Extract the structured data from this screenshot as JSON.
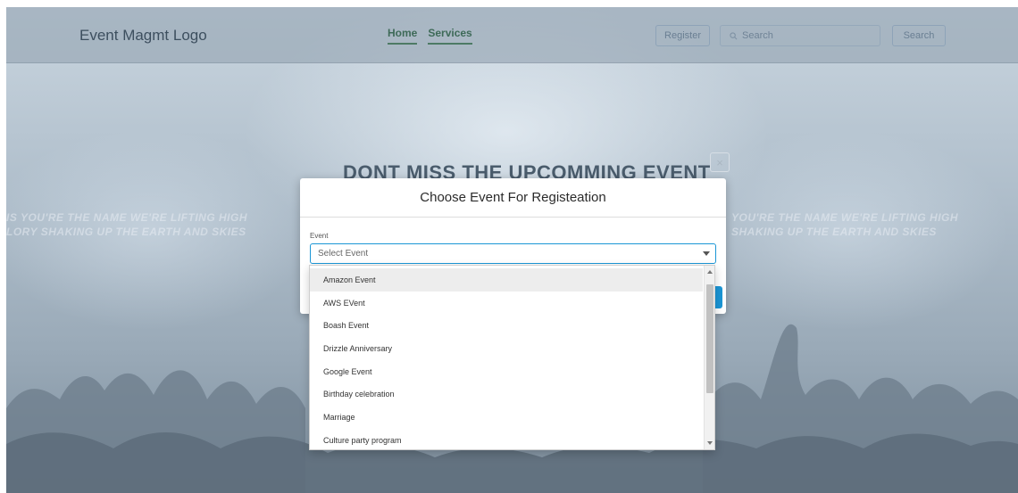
{
  "navbar": {
    "logo": "Event Magmt Logo",
    "links": [
      "Home",
      "Services"
    ],
    "register_label": "Register",
    "search_placeholder": "Search",
    "search_button": "Search"
  },
  "hero": {
    "title": "DONT MISS THE UPCOMMING EVENT",
    "left_text": [
      "IS YOU'RE THE NAME WE'RE LIFTING HIGH",
      "LORY SHAKING UP THE EARTH AND SKIES"
    ],
    "right_text": [
      "YOU'RE THE NAME WE'RE LIFTING HIGH",
      "SHAKING UP THE EARTH AND SKIES"
    ],
    "close_glyph": "×"
  },
  "modal": {
    "title": "Choose Event For Registeation",
    "field_label": "Event",
    "select_value": "Select Event",
    "options": [
      "Amazon Event",
      "AWS EVent",
      "Boash Event",
      "Drizzle Anniversary",
      "Google Event",
      "Birthday celebration",
      "Marriage",
      "Culture party program"
    ],
    "highlighted_index": 0
  },
  "colors": {
    "accent": "#1b96d6",
    "nav_link": "#3e6a58",
    "overlay": "#9aaab8"
  }
}
